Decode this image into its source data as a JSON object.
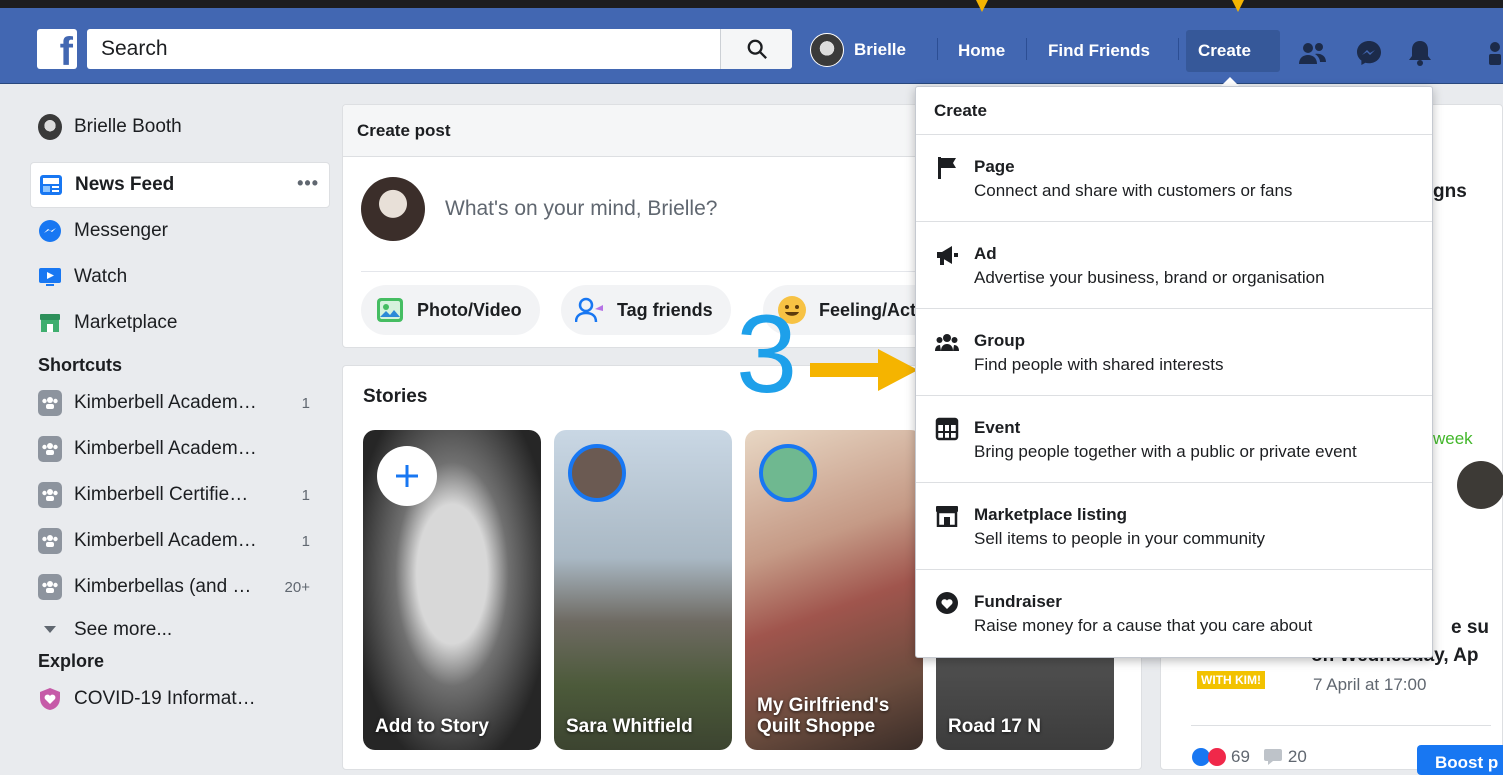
{
  "topbar": {
    "logo": "f",
    "search_placeholder": "Search",
    "profile_name": "Brielle",
    "nav": [
      "Home",
      "Find Friends",
      "Create"
    ]
  },
  "sidebar": {
    "user": "Brielle Booth",
    "items": [
      {
        "label": "News Feed",
        "more": "•••"
      },
      {
        "label": "Messenger"
      },
      {
        "label": "Watch"
      },
      {
        "label": "Marketplace"
      }
    ],
    "shortcuts_title": "Shortcuts",
    "shortcuts": [
      {
        "label": "Kimberbell Academ…",
        "count": "1"
      },
      {
        "label": "Kimberbell Academ…",
        "count": ""
      },
      {
        "label": "Kimberbell Certifie…",
        "count": "1"
      },
      {
        "label": "Kimberbell Academ…",
        "count": "1"
      },
      {
        "label": "Kimberbellas (and …",
        "count": "20+"
      }
    ],
    "see_more": "See more...",
    "explore_title": "Explore",
    "explore": [
      {
        "label": "COVID-19 Informat…"
      }
    ]
  },
  "create_post": {
    "title": "Create post",
    "placeholder": "What's on your mind, Brielle?",
    "actions": [
      "Photo/Video",
      "Tag friends",
      "Feeling/Acti"
    ]
  },
  "stories": {
    "title": "Stories",
    "items": [
      {
        "label": "Add to Story"
      },
      {
        "label": "Sara Whitfield"
      },
      {
        "label": "My Girlfriend's\nQuilt Shoppe"
      },
      {
        "label": "Road 17 N"
      }
    ]
  },
  "right": {
    "snippet1": "gns",
    "snippet2": "week",
    "snippet3": "e su",
    "snippet4": "on Wednesday, Ap",
    "date": "7 April at 17:00",
    "badge": "WITH KIM!",
    "reactions": "69",
    "comments": "20",
    "boost": "Boost p"
  },
  "create_menu": {
    "title": "Create",
    "items": [
      {
        "icon": "flag-icon",
        "title": "Page",
        "subtitle": "Connect and share with customers or fans"
      },
      {
        "icon": "megaphone-icon",
        "title": "Ad",
        "subtitle": "Advertise your business, brand or organisation"
      },
      {
        "icon": "group-icon",
        "title": "Group",
        "subtitle": "Find people with shared interests"
      },
      {
        "icon": "calendar-icon",
        "title": "Event",
        "subtitle": "Bring people together with a public or private event"
      },
      {
        "icon": "storefront-icon",
        "title": "Marketplace listing",
        "subtitle": "Sell items to people in your community"
      },
      {
        "icon": "fundraiser-icon",
        "title": "Fundraiser",
        "subtitle": "Raise money for a cause that you care about"
      }
    ]
  },
  "annotation": {
    "step": "3",
    "arrow_color": "#f5b400",
    "step_color": "#1ea0ea"
  },
  "colors": {
    "brand": "#4267b2",
    "accent": "#1877f2"
  }
}
